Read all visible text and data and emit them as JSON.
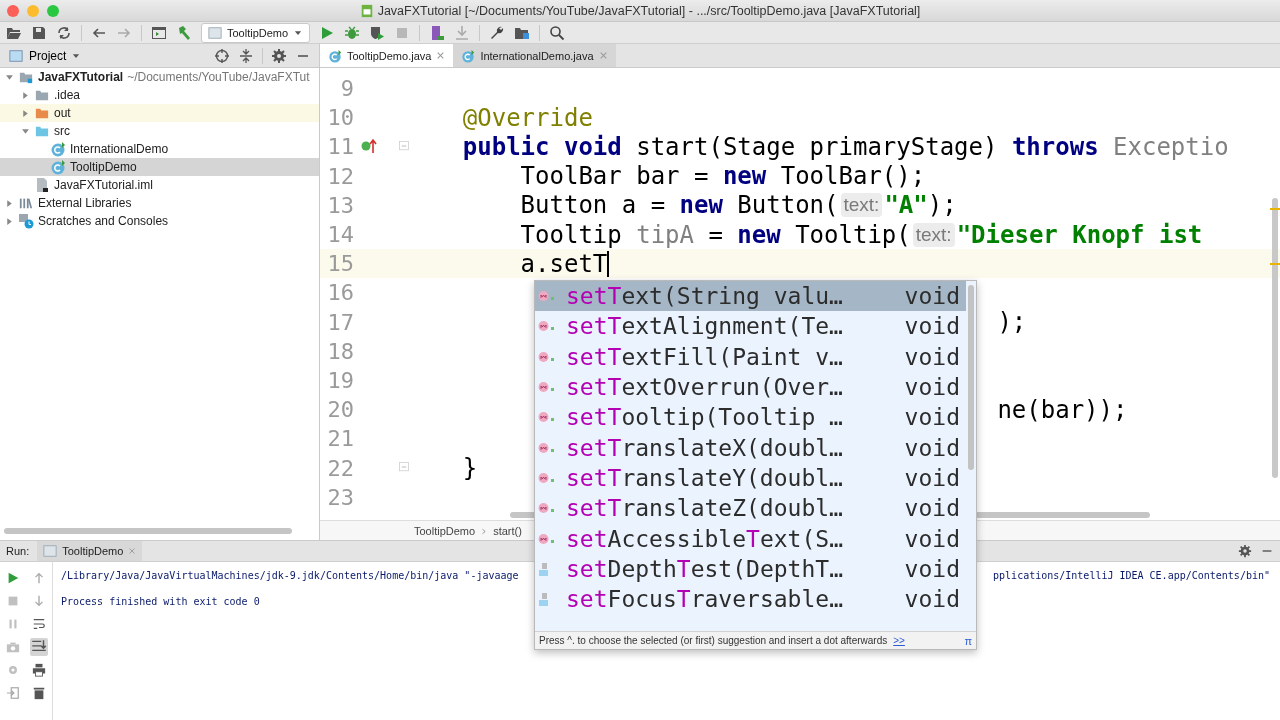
{
  "window": {
    "title": "JavaFXTutorial [~/Documents/YouTube/JavaFXTutorial] - .../src/TooltipDemo.java [JavaFXTutorial]"
  },
  "toolbar": {
    "run_configuration": "TooltipDemo"
  },
  "project_panel": {
    "title": "Project",
    "tree": [
      {
        "label": "JavaFXTutorial",
        "path": "~/Documents/YouTube/JavaFXTut",
        "kind": "module",
        "expanded": true,
        "selected": false,
        "highlighted": false,
        "children": [
          {
            "label": ".idea",
            "kind": "folder",
            "expanded": false,
            "selected": false,
            "highlighted": false
          },
          {
            "label": "out",
            "kind": "folder-excluded",
            "expanded": false,
            "selected": false,
            "highlighted": true
          },
          {
            "label": "src",
            "kind": "folder-source",
            "expanded": true,
            "selected": false,
            "highlighted": false,
            "children": [
              {
                "label": "InternationalDemo",
                "kind": "class",
                "selected": false,
                "highlighted": false
              },
              {
                "label": "TooltipDemo",
                "kind": "class",
                "selected": true,
                "highlighted": false
              }
            ]
          },
          {
            "label": "JavaFXTutorial.iml",
            "kind": "iml",
            "selected": false,
            "highlighted": false
          }
        ]
      },
      {
        "label": "External Libraries",
        "kind": "libraries",
        "expanded": false,
        "selected": false,
        "highlighted": false
      },
      {
        "label": "Scratches and Consoles",
        "kind": "scratches",
        "expanded": false,
        "selected": false,
        "highlighted": false
      }
    ]
  },
  "editor_tabs": [
    {
      "label": "TooltipDemo.java",
      "selected": true
    },
    {
      "label": "InternationalDemo.java",
      "selected": false
    }
  ],
  "editor": {
    "lines": [
      {
        "number": "9",
        "current": false,
        "fold": false,
        "override_marker": false,
        "caret": false
      },
      {
        "number": "10",
        "current": false,
        "fold": false,
        "override_marker": false,
        "caret": false,
        "segments": [
          {
            "kind": "annotation",
            "text": "    @Override"
          }
        ]
      },
      {
        "number": "11",
        "current": false,
        "fold": true,
        "override_marker": true,
        "caret": false,
        "segments": [
          {
            "kind": "keyword",
            "text": "    public void"
          },
          {
            "kind": "plain",
            "text": " start(Stage primaryStage) "
          },
          {
            "kind": "keyword",
            "text": "throws"
          },
          {
            "kind": "muted",
            "text": " Exceptio"
          }
        ]
      },
      {
        "number": "12",
        "current": false,
        "fold": false,
        "override_marker": false,
        "caret": false,
        "segments": [
          {
            "kind": "plain",
            "text": "        ToolBar bar = "
          },
          {
            "kind": "keyword",
            "text": "new"
          },
          {
            "kind": "plain",
            "text": " ToolBar();"
          }
        ]
      },
      {
        "number": "13",
        "current": false,
        "fold": false,
        "override_marker": false,
        "caret": false,
        "segments": [
          {
            "kind": "plain",
            "text": "        Button a = "
          },
          {
            "kind": "keyword",
            "text": "new"
          },
          {
            "kind": "plain",
            "text": " Button("
          },
          {
            "kind": "hint",
            "text": "text:"
          },
          {
            "kind": "string",
            "text": "\"A\""
          },
          {
            "kind": "plain",
            "text": ");"
          }
        ]
      },
      {
        "number": "14",
        "current": false,
        "fold": false,
        "override_marker": false,
        "caret": false,
        "segments": [
          {
            "kind": "plain",
            "text": "        Tooltip "
          },
          {
            "kind": "muted",
            "text": "tipA"
          },
          {
            "kind": "plain",
            "text": " = "
          },
          {
            "kind": "keyword",
            "text": "new"
          },
          {
            "kind": "plain",
            "text": " Tooltip("
          },
          {
            "kind": "hint",
            "text": "text:"
          },
          {
            "kind": "string",
            "text": "\"Dieser Knopf ist"
          }
        ]
      },
      {
        "number": "15",
        "current": true,
        "fold": false,
        "override_marker": false,
        "caret": true,
        "segments": [
          {
            "kind": "plain",
            "text": "        a.setT"
          }
        ]
      },
      {
        "number": "16",
        "current": false,
        "fold": false,
        "override_marker": false,
        "caret": false
      },
      {
        "number": "17",
        "current": false,
        "fold": false,
        "override_marker": false,
        "caret": false,
        "segments": [
          {
            "kind": "plain",
            "text": "                                         );"
          }
        ]
      },
      {
        "number": "18",
        "current": false,
        "fold": false,
        "override_marker": false,
        "caret": false
      },
      {
        "number": "19",
        "current": false,
        "fold": false,
        "override_marker": false,
        "caret": false
      },
      {
        "number": "20",
        "current": false,
        "fold": false,
        "override_marker": false,
        "caret": false,
        "segments": [
          {
            "kind": "plain",
            "text": "                                         ne(bar));"
          }
        ]
      },
      {
        "number": "21",
        "current": false,
        "fold": false,
        "override_marker": false,
        "caret": false
      },
      {
        "number": "22",
        "current": false,
        "fold": true,
        "override_marker": false,
        "caret": false,
        "segments": [
          {
            "kind": "plain",
            "text": "    }"
          }
        ]
      },
      {
        "number": "23",
        "current": false,
        "fold": false,
        "override_marker": false,
        "caret": false
      }
    ],
    "breadcrumbs": [
      "TooltipDemo",
      "start()"
    ]
  },
  "completion": {
    "items": [
      {
        "kind": "method",
        "name": "**setT**ext(String valu…",
        "type": "void",
        "selected": true
      },
      {
        "kind": "method",
        "name": "**setT**extAlignment(Te…",
        "type": "void",
        "selected": false
      },
      {
        "kind": "method",
        "name": "**setT**extFill(Paint v…",
        "type": "void",
        "selected": false
      },
      {
        "kind": "method",
        "name": "**setT**extOverrun(Over…",
        "type": "void",
        "selected": false
      },
      {
        "kind": "method",
        "name": "**setT**ooltip(Tooltip …",
        "type": "void",
        "selected": false
      },
      {
        "kind": "method",
        "name": "**setT**ranslateX(doubl…",
        "type": "void",
        "selected": false
      },
      {
        "kind": "method",
        "name": "**setT**ranslateY(doubl…",
        "type": "void",
        "selected": false
      },
      {
        "kind": "method",
        "name": "**setT**ranslateZ(doubl…",
        "type": "void",
        "selected": false
      },
      {
        "kind": "method",
        "name": "**set**Accessible**T**ext(S…",
        "type": "void",
        "selected": false
      },
      {
        "kind": "field",
        "name": "**set**Depth**T**est(DepthT…",
        "type": "void",
        "selected": false
      },
      {
        "kind": "field",
        "name": "**set**Focus**T**raversable…",
        "type": "void",
        "selected": false
      }
    ],
    "hint": "Press ^. to choose the selected (or first) suggestion and insert a dot afterwards",
    "hint_link": ">>",
    "corner": "π"
  },
  "run_panel": {
    "label": "Run:",
    "tab": "TooltipDemo",
    "console": [
      {
        "text": "/Library/Java/JavaVirtualMachines/jdk-9.jdk/Contents/Home/bin/java \"-javaage",
        "continued": "pplications/IntelliJ IDEA CE.app/Contents/bin\""
      },
      {
        "text": "Process finished with exit code 0"
      }
    ]
  }
}
